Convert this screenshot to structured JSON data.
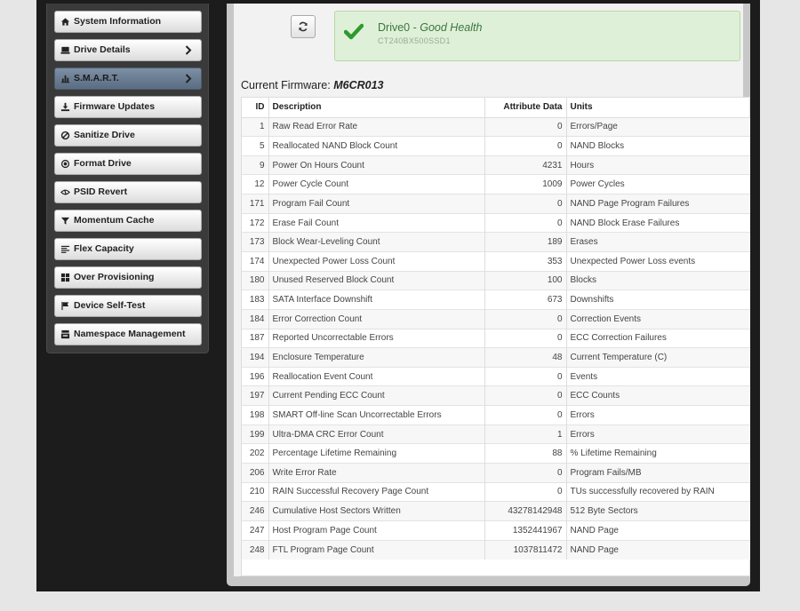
{
  "sidebar": {
    "items": [
      {
        "label": "System Information",
        "icon": "home-icon",
        "chevron": false,
        "active": false
      },
      {
        "label": "Drive Details",
        "icon": "drive-icon",
        "chevron": true,
        "active": false
      },
      {
        "label": "S.M.A.R.T.",
        "icon": "bar-chart-icon",
        "chevron": true,
        "active": true
      },
      {
        "label": "Firmware Updates",
        "icon": "download-icon",
        "chevron": false,
        "active": false
      },
      {
        "label": "Sanitize Drive",
        "icon": "ban-icon",
        "chevron": false,
        "active": false
      },
      {
        "label": "Format Drive",
        "icon": "record-icon",
        "chevron": false,
        "active": false
      },
      {
        "label": "PSID Revert",
        "icon": "psid-icon",
        "chevron": false,
        "active": false
      },
      {
        "label": "Momentum Cache",
        "icon": "filter-icon",
        "chevron": false,
        "active": false
      },
      {
        "label": "Flex Capacity",
        "icon": "align-icon",
        "chevron": false,
        "active": false
      },
      {
        "label": "Over Provisioning",
        "icon": "grid-icon",
        "chevron": false,
        "active": false
      },
      {
        "label": "Device Self-Test",
        "icon": "flag-icon",
        "chevron": false,
        "active": false
      },
      {
        "label": "Namespace Management",
        "icon": "inbox-icon",
        "chevron": false,
        "active": false
      }
    ]
  },
  "health": {
    "drive_name": "Drive0",
    "separator": " - ",
    "status": "Good Health",
    "model": "CT240BX500SSD1",
    "icon": "checkmark-icon"
  },
  "firmware": {
    "label": "Current Firmware:",
    "value": "M6CR013"
  },
  "table": {
    "headers": {
      "id": "ID",
      "description": "Description",
      "data": "Attribute Data",
      "units": "Units"
    },
    "rows": [
      {
        "id": "1",
        "description": "Raw Read Error Rate",
        "data": "0",
        "units": "Errors/Page"
      },
      {
        "id": "5",
        "description": "Reallocated NAND Block Count",
        "data": "0",
        "units": "NAND Blocks"
      },
      {
        "id": "9",
        "description": "Power On Hours Count",
        "data": "4231",
        "units": "Hours"
      },
      {
        "id": "12",
        "description": "Power Cycle Count",
        "data": "1009",
        "units": "Power Cycles"
      },
      {
        "id": "171",
        "description": "Program Fail Count",
        "data": "0",
        "units": "NAND Page Program Failures"
      },
      {
        "id": "172",
        "description": "Erase Fail Count",
        "data": "0",
        "units": "NAND Block Erase Failures"
      },
      {
        "id": "173",
        "description": "Block Wear-Leveling Count",
        "data": "189",
        "units": "Erases"
      },
      {
        "id": "174",
        "description": "Unexpected Power Loss Count",
        "data": "353",
        "units": "Unexpected Power Loss events"
      },
      {
        "id": "180",
        "description": "Unused Reserved Block Count",
        "data": "100",
        "units": "Blocks"
      },
      {
        "id": "183",
        "description": "SATA Interface Downshift",
        "data": "673",
        "units": "Downshifts"
      },
      {
        "id": "184",
        "description": "Error Correction Count",
        "data": "0",
        "units": "Correction Events"
      },
      {
        "id": "187",
        "description": "Reported Uncorrectable Errors",
        "data": "0",
        "units": "ECC Correction Failures"
      },
      {
        "id": "194",
        "description": "Enclosure Temperature",
        "data": "48",
        "units": "Current Temperature (C)"
      },
      {
        "id": "196",
        "description": "Reallocation Event Count",
        "data": "0",
        "units": "Events"
      },
      {
        "id": "197",
        "description": "Current Pending ECC Count",
        "data": "0",
        "units": "ECC Counts"
      },
      {
        "id": "198",
        "description": "SMART Off-line Scan Uncorrectable Errors",
        "data": "0",
        "units": "Errors"
      },
      {
        "id": "199",
        "description": "Ultra-DMA CRC Error Count",
        "data": "1",
        "units": "Errors"
      },
      {
        "id": "202",
        "description": "Percentage Lifetime Remaining",
        "data": "88",
        "units": "% Lifetime Remaining"
      },
      {
        "id": "206",
        "description": "Write Error Rate",
        "data": "0",
        "units": "Program Fails/MB"
      },
      {
        "id": "210",
        "description": "RAIN Successful Recovery Page Count",
        "data": "0",
        "units": "TUs successfully recovered by RAIN"
      },
      {
        "id": "246",
        "description": "Cumulative Host Sectors Written",
        "data": "43278142948",
        "units": "512 Byte Sectors"
      },
      {
        "id": "247",
        "description": "Host Program Page Count",
        "data": "1352441967",
        "units": "NAND Page"
      },
      {
        "id": "248",
        "description": "FTL Program Page Count",
        "data": "1037811472",
        "units": "NAND Page"
      }
    ]
  },
  "toolbar": {
    "refresh_icon": "refresh-icon"
  }
}
